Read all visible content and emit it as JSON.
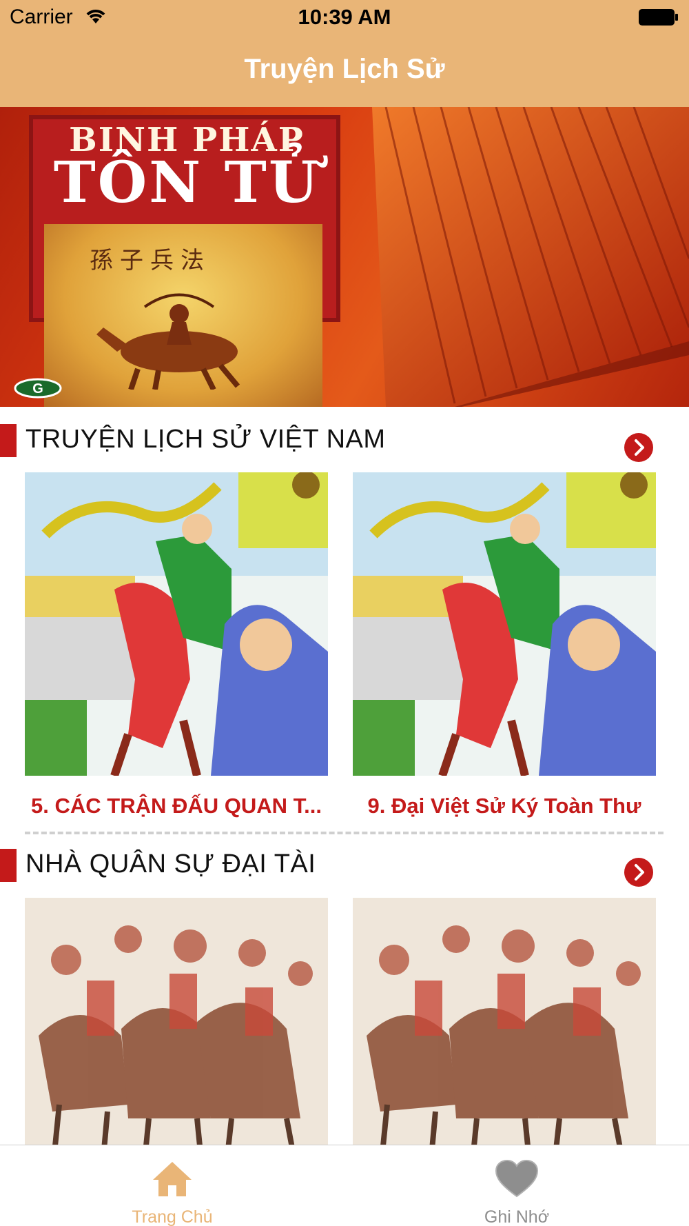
{
  "status_bar": {
    "carrier": "Carrier",
    "time": "10:39 AM"
  },
  "nav": {
    "title": "Truyện Lịch Sử"
  },
  "banner": {
    "line1": "BINH PHÁP",
    "line2": "TÔN TỬ",
    "chinese": "孫子兵法"
  },
  "sections": [
    {
      "title": "TRUYỆN LỊCH SỬ VIỆT NAM",
      "items": [
        {
          "label": "5. CÁC TRẬN ĐẤU QUAN T..."
        },
        {
          "label": "9. Đại Việt Sử Ký Toàn Thư"
        }
      ]
    },
    {
      "title": "NHÀ QUÂN SỰ ĐẠI TÀI",
      "items": [
        {
          "label": ""
        },
        {
          "label": ""
        }
      ]
    }
  ],
  "tabs": [
    {
      "label": "Trang Chủ",
      "icon": "home-icon",
      "active": true
    },
    {
      "label": "Ghi Nhớ",
      "icon": "heart-icon",
      "active": false
    }
  ],
  "colors": {
    "header": "#e9b577",
    "accent": "#c41a1a",
    "tab_active": "#e9b577",
    "tab_inactive": "#8e8e8e"
  }
}
